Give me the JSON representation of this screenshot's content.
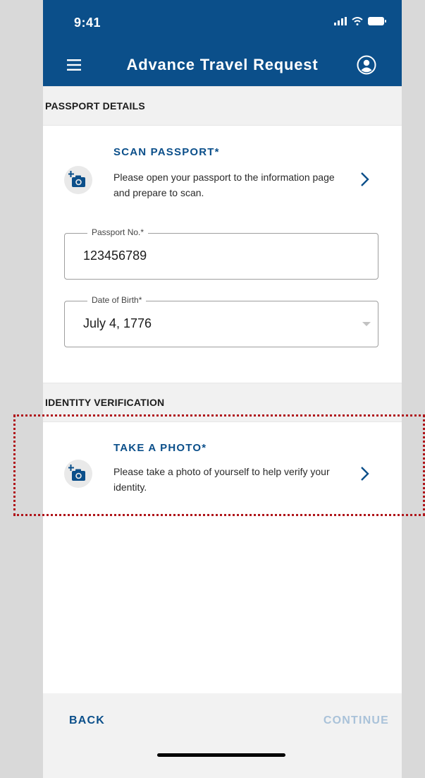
{
  "status_bar": {
    "time": "9:41",
    "icons": [
      "signal-icon",
      "wifi-icon",
      "battery-icon"
    ]
  },
  "app_bar": {
    "title": "Advance Travel Request",
    "menu_icon": "menu-icon",
    "profile_icon": "profile-icon"
  },
  "passport_section": {
    "header": "PASSPORT DETAILS",
    "scan": {
      "title": "SCAN PASSPORT*",
      "description": "Please open your passport to the information page and prepare to scan.",
      "icon": "add-photo-icon"
    },
    "passport_no": {
      "label": "Passport No.*",
      "value": "123456789"
    },
    "dob": {
      "label": "Date of Birth*",
      "value": "July 4, 1776"
    }
  },
  "identity_section": {
    "header": "IDENTITY VERIFICATION",
    "photo": {
      "title": "TAKE A PHOTO*",
      "description": "Please take a photo of yourself to help verify your identity.",
      "icon": "add-photo-icon"
    }
  },
  "footer": {
    "back_label": "BACK",
    "continue_label": "CONTINUE"
  },
  "colors": {
    "brand": "#0b4f8a",
    "disabled": "#a9c2d9",
    "highlight": "#b0161b"
  }
}
